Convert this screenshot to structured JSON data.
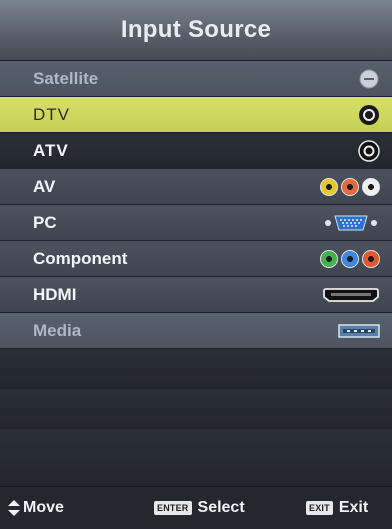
{
  "title": "Input Source",
  "items": [
    {
      "label": "Satellite",
      "icon": "satellite-dish-icon",
      "state": "disabled"
    },
    {
      "label": "DTV",
      "icon": "coaxial-antenna-icon",
      "state": "selected"
    },
    {
      "label": "ATV",
      "icon": "coaxial-antenna-icon",
      "state": "normal"
    },
    {
      "label": "AV",
      "icon": "composite-av-ports-icon",
      "state": "normal",
      "colors": [
        "#e6c82c",
        "#e36a3e",
        "#eeeeee"
      ]
    },
    {
      "label": "PC",
      "icon": "vga-port-icon",
      "state": "normal"
    },
    {
      "label": "Component",
      "icon": "component-ports-icon",
      "state": "normal",
      "colors": [
        "#44b24f",
        "#3f86e0",
        "#e3572f"
      ]
    },
    {
      "label": "HDMI",
      "icon": "hdmi-port-icon",
      "state": "normal"
    },
    {
      "label": "Media",
      "icon": "usb-port-icon",
      "state": "disabled"
    }
  ],
  "footer": {
    "move_label": "Move",
    "select_key": "ENTER",
    "select_label": "Select",
    "exit_key": "EXIT",
    "exit_label": "Exit"
  },
  "colors": {
    "selected_highlight": "#d1d95e",
    "title_bar": "#6c7380"
  }
}
